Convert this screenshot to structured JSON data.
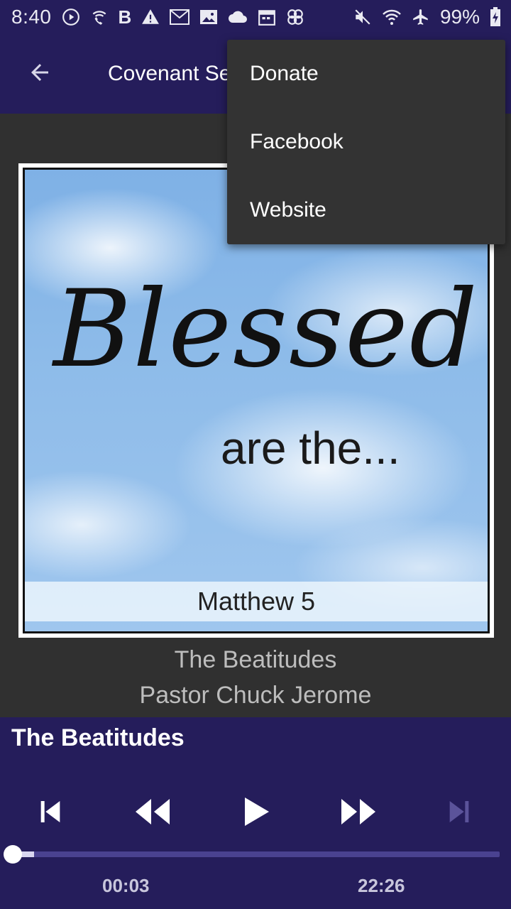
{
  "status_bar": {
    "time": "8:40",
    "battery_text": "99%",
    "left_icons": [
      "play-circle-icon",
      "wifi-call-icon",
      "b-icon",
      "warning-icon",
      "gmail-icon",
      "image-icon",
      "cloud-icon",
      "calendar-icon",
      "pinwheel-icon"
    ],
    "right_icons": [
      "mute-icon",
      "wifi-icon",
      "airplane-icon",
      "battery-charging-icon"
    ],
    "b_glyph": "B"
  },
  "app_bar": {
    "title": "Covenant Se",
    "back_icon": "arrow-back-icon",
    "background": "#251d5b"
  },
  "menu": {
    "items": [
      {
        "label": "Donate"
      },
      {
        "label": "Facebook"
      },
      {
        "label": "Website"
      }
    ],
    "background": "#333333"
  },
  "artwork": {
    "text_main": "Blessed",
    "text_sub": "are the...",
    "text_band": "Matthew 5"
  },
  "now_playing": {
    "title": "The Beatitudes",
    "artist": "Pastor Chuck Jerome"
  },
  "player": {
    "title": "The Beatitudes",
    "current_time": "00:03",
    "total_time": "22:26",
    "progress_fraction": 0.0022,
    "controls": [
      "skip-previous-icon",
      "rewind-icon",
      "play-icon",
      "fast-forward-icon",
      "skip-next-icon"
    ],
    "skip_next_enabled": false,
    "accent": "#251d5b"
  }
}
